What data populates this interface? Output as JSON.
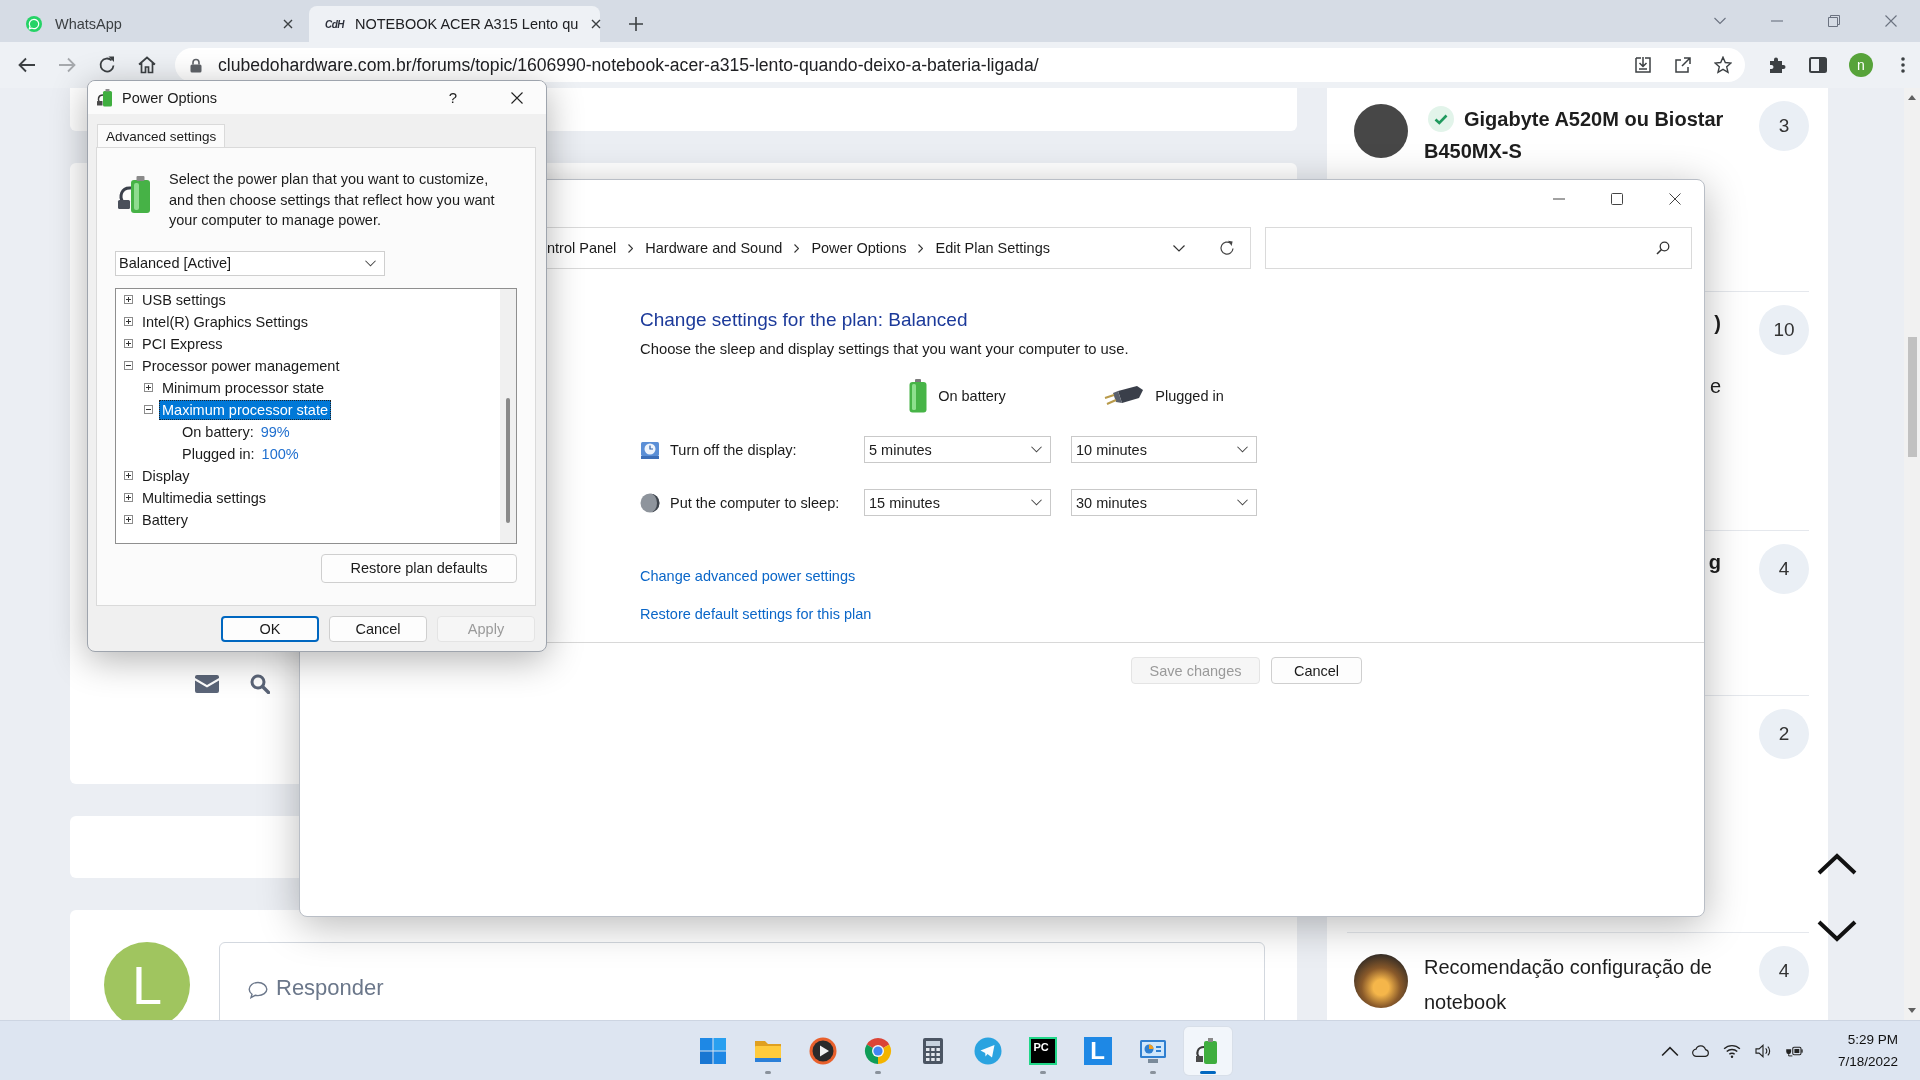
{
  "browser": {
    "tabs": [
      {
        "kind": "chat",
        "title": "WhatsApp",
        "selected": false
      },
      {
        "kind": "site",
        "favicon_text": "CdH",
        "title": "NOTEBOOK ACER A315 Lento qu",
        "selected": true
      }
    ],
    "url": "clubedohardware.com.br/forums/topic/1606990-notebook-acer-a315-lento-quando-deixo-a-bateria-ligada/",
    "profile_initial": "n"
  },
  "page": {
    "sidebar": [
      {
        "kind": "full",
        "avatar": {
          "kind": "plain"
        },
        "solved": true,
        "unread": true,
        "title": "Gigabyte A520M ou Biostar B450MX-S",
        "count": "3"
      },
      {
        "kind": "covered",
        "unread": true,
        "title": ")",
        "excerpt": "e",
        "count": "10"
      },
      {
        "kind": "covered",
        "unread": true,
        "title": "g",
        "count": "4"
      },
      {
        "kind": "covered",
        "count": "2"
      },
      {
        "kind": "full",
        "avatar": {
          "kind": "photo"
        },
        "unread": false,
        "title": "Recomendação configuração de notebook",
        "count": "4"
      }
    ],
    "reply": {
      "avatar_initial": "L",
      "placeholder": "Responder"
    }
  },
  "power_options": {
    "title": "Power Options",
    "help_label": "?",
    "tabs": [
      {
        "label": "Advanced settings",
        "selected": true
      }
    ],
    "description": "Select the power plan that you want to customize, and then choose settings that reflect how you want your computer to manage power.",
    "plan": "Balanced [Active]",
    "tree": [
      {
        "label": "USB settings",
        "expanded": false,
        "selected": false
      },
      {
        "label": "Intel(R) Graphics Settings",
        "expanded": false,
        "selected": false
      },
      {
        "label": "PCI Express",
        "expanded": false,
        "selected": false
      },
      {
        "label": "Processor power management",
        "expanded": true,
        "selected": false,
        "children": [
          {
            "label": "Minimum processor state",
            "expanded": false,
            "selected": false
          },
          {
            "label": "Maximum processor state",
            "expanded": true,
            "selected": true,
            "children": [
              {
                "label": "On battery:",
                "value": "99%",
                "selected": false
              },
              {
                "label": "Plugged in:",
                "value": "100%",
                "selected": false
              }
            ]
          }
        ]
      },
      {
        "label": "Display",
        "expanded": false,
        "selected": false
      },
      {
        "label": "Multimedia settings",
        "expanded": false,
        "selected": false
      },
      {
        "label": "Battery",
        "expanded": false,
        "selected": false
      }
    ],
    "restore_label": "Restore plan defaults",
    "buttons": [
      {
        "label": "OK",
        "default": true,
        "disabled": false
      },
      {
        "label": "Cancel",
        "default": false,
        "disabled": false
      },
      {
        "label": "Apply",
        "default": false,
        "disabled": true
      }
    ]
  },
  "edit_plan": {
    "breadcrumb": [
      "ntrol Panel",
      "Hardware and Sound",
      "Power Options",
      "Edit Plan Settings"
    ],
    "heading": "Change settings for the plan: Balanced",
    "subheading": "Choose the sleep and display settings that you want your computer to use.",
    "columns": [
      {
        "kind": "battery",
        "label": "On battery"
      },
      {
        "kind": "plug",
        "label": "Plugged in"
      }
    ],
    "rows": [
      {
        "kind": "display",
        "label": "Turn off the display:",
        "values": [
          "5 minutes",
          "10 minutes"
        ]
      },
      {
        "kind": "sleep",
        "label": "Put the computer to sleep:",
        "values": [
          "15 minutes",
          "30 minutes"
        ]
      }
    ],
    "links": [
      "Change advanced power settings",
      "Restore default settings for this plan"
    ],
    "buttons": [
      {
        "label": "Save changes",
        "disabled": true
      },
      {
        "label": "Cancel",
        "disabled": false
      }
    ]
  },
  "taskbar": {
    "apps": [
      {
        "kind": "start",
        "running": false,
        "active": false
      },
      {
        "kind": "folder",
        "running": true,
        "active": false
      },
      {
        "kind": "player",
        "running": false,
        "active": false
      },
      {
        "kind": "browser",
        "running": true,
        "active": false
      },
      {
        "kind": "calculator",
        "running": false,
        "active": false
      },
      {
        "kind": "messenger",
        "running": false,
        "active": false
      },
      {
        "kind": "pc",
        "glyph": "PC",
        "running": true,
        "active": false
      },
      {
        "kind": "letter",
        "glyph": "L",
        "running": false,
        "active": false
      },
      {
        "kind": "control",
        "running": true,
        "active": false
      },
      {
        "kind": "power",
        "running": true,
        "active": true
      }
    ],
    "clock": {
      "time": "5:29 PM",
      "date": "7/18/2022"
    }
  }
}
